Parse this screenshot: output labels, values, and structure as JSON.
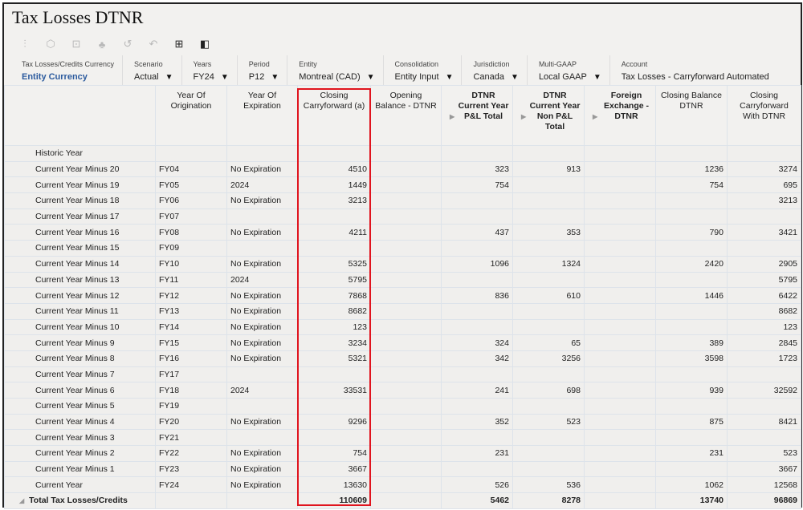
{
  "title": "Tax Losses DTNR",
  "toolbar": [
    {
      "icon": "adjust-sliders-icon",
      "enabled": false
    },
    {
      "icon": "cube-icon",
      "enabled": false
    },
    {
      "icon": "comment-add-icon",
      "enabled": false
    },
    {
      "icon": "hierarchy-icon",
      "enabled": false
    },
    {
      "icon": "history-icon",
      "enabled": false
    },
    {
      "icon": "undo-icon",
      "enabled": false
    },
    {
      "icon": "grid-icon",
      "enabled": true
    },
    {
      "icon": "panel-icon",
      "enabled": true
    }
  ],
  "pov": [
    {
      "label": "Tax Losses/Credits Currency",
      "value": "Entity Currency",
      "dropdown": false
    },
    {
      "label": "Scenario",
      "value": "Actual",
      "dropdown": true
    },
    {
      "label": "Years",
      "value": "FY24",
      "dropdown": true
    },
    {
      "label": "Period",
      "value": "P12",
      "dropdown": true
    },
    {
      "label": "Entity",
      "value": "Montreal (CAD)",
      "dropdown": true
    },
    {
      "label": "Consolidation",
      "value": "Entity Input",
      "dropdown": true
    },
    {
      "label": "Jurisdiction",
      "value": "Canada",
      "dropdown": true
    },
    {
      "label": "Multi-GAAP",
      "value": "Local GAAP",
      "dropdown": true
    },
    {
      "label": "Account",
      "value": "Tax Losses - Carryforward Automated",
      "dropdown": false
    }
  ],
  "columns": [
    "",
    "Year Of Origination",
    "Year Of Expiration",
    "Closing Carryforward (a)",
    "Opening Balance - DTNR",
    "DTNR Current Year P&L Total",
    "DTNR Current Year Non P&L Total",
    "Foreign Exchange - DTNR",
    "Closing Balance DTNR",
    "Closing Carryforward With DTNR"
  ],
  "section_label": "Historic Year",
  "rows": [
    [
      "Current Year Minus 20",
      "FY04",
      "No Expiration",
      "4510",
      "",
      "323",
      "913",
      "",
      "1236",
      "3274"
    ],
    [
      "Current Year Minus 19",
      "FY05",
      "2024",
      "1449",
      "",
      "754",
      "",
      "",
      "754",
      "695"
    ],
    [
      "Current Year Minus 18",
      "FY06",
      "No Expiration",
      "3213",
      "",
      "",
      "",
      "",
      "",
      "3213"
    ],
    [
      "Current Year Minus 17",
      "FY07",
      "",
      "",
      "",
      "",
      "",
      "",
      "",
      ""
    ],
    [
      "Current Year Minus 16",
      "FY08",
      "No Expiration",
      "4211",
      "",
      "437",
      "353",
      "",
      "790",
      "3421"
    ],
    [
      "Current Year Minus 15",
      "FY09",
      "",
      "",
      "",
      "",
      "",
      "",
      "",
      ""
    ],
    [
      "Current Year Minus 14",
      "FY10",
      "No Expiration",
      "5325",
      "",
      "1096",
      "1324",
      "",
      "2420",
      "2905"
    ],
    [
      "Current Year Minus 13",
      "FY11",
      "2024",
      "5795",
      "",
      "",
      "",
      "",
      "",
      "5795"
    ],
    [
      "Current Year Minus 12",
      "FY12",
      "No Expiration",
      "7868",
      "",
      "836",
      "610",
      "",
      "1446",
      "6422"
    ],
    [
      "Current Year Minus 11",
      "FY13",
      "No Expiration",
      "8682",
      "",
      "",
      "",
      "",
      "",
      "8682"
    ],
    [
      "Current Year Minus 10",
      "FY14",
      "No Expiration",
      "123",
      "",
      "",
      "",
      "",
      "",
      "123"
    ],
    [
      "Current Year Minus 9",
      "FY15",
      "No Expiration",
      "3234",
      "",
      "324",
      "65",
      "",
      "389",
      "2845"
    ],
    [
      "Current Year Minus 8",
      "FY16",
      "No Expiration",
      "5321",
      "",
      "342",
      "3256",
      "",
      "3598",
      "1723"
    ],
    [
      "Current Year Minus 7",
      "FY17",
      "",
      "",
      "",
      "",
      "",
      "",
      "",
      ""
    ],
    [
      "Current Year Minus 6",
      "FY18",
      "2024",
      "33531",
      "",
      "241",
      "698",
      "",
      "939",
      "32592"
    ],
    [
      "Current Year Minus 5",
      "FY19",
      "",
      "",
      "",
      "",
      "",
      "",
      "",
      ""
    ],
    [
      "Current Year Minus 4",
      "FY20",
      "No Expiration",
      "9296",
      "",
      "352",
      "523",
      "",
      "875",
      "8421"
    ],
    [
      "Current Year Minus 3",
      "FY21",
      "",
      "",
      "",
      "",
      "",
      "",
      "",
      ""
    ],
    [
      "Current Year Minus 2",
      "FY22",
      "No Expiration",
      "754",
      "",
      "231",
      "",
      "",
      "231",
      "523"
    ],
    [
      "Current Year Minus 1",
      "FY23",
      "No Expiration",
      "3667",
      "",
      "",
      "",
      "",
      "",
      "3667"
    ],
    [
      "Current Year",
      "FY24",
      "No Expiration",
      "13630",
      "",
      "526",
      "536",
      "",
      "1062",
      "12568"
    ]
  ],
  "total": [
    "Total Tax Losses/Credits",
    "",
    "",
    "110609",
    "",
    "5462",
    "8278",
    "",
    "13740",
    "96869"
  ],
  "highlight_color": "#e0141e"
}
